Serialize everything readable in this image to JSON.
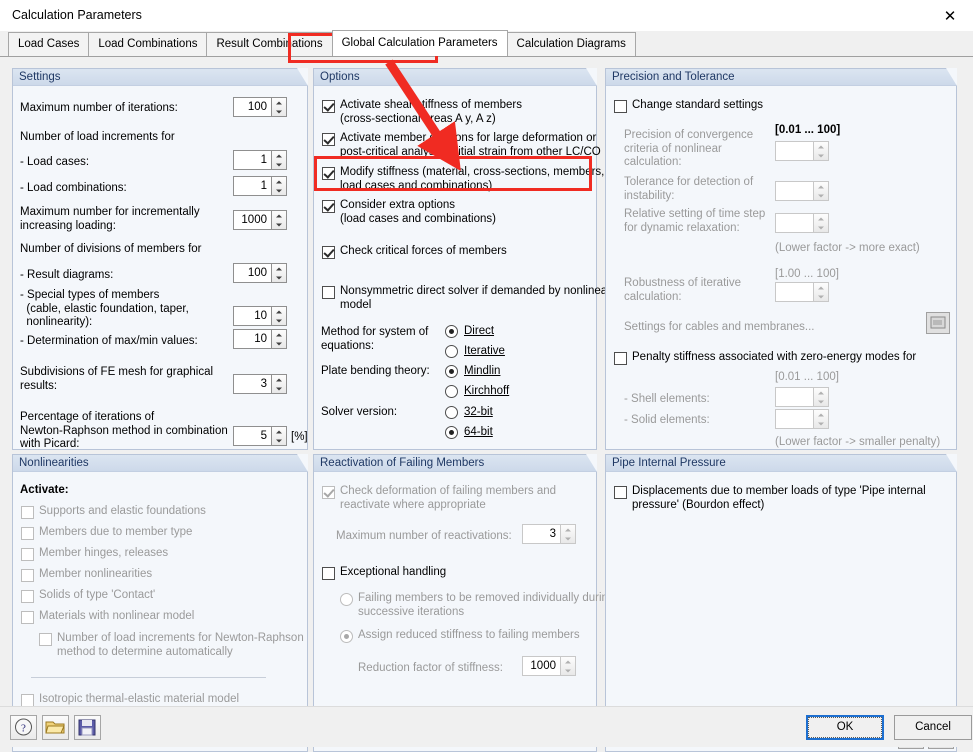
{
  "window": {
    "title": "Calculation Parameters",
    "close_icon": "close-icon"
  },
  "tabs": [
    {
      "label": "Load Cases",
      "active": false
    },
    {
      "label": "Load Combinations",
      "active": false
    },
    {
      "label": "Result Combinations",
      "active": false
    },
    {
      "label": "Global Calculation Parameters",
      "active": true
    },
    {
      "label": "Calculation Diagrams",
      "active": false
    }
  ],
  "settings": {
    "title": "Settings",
    "max_iterations_label": "Maximum number of iterations:",
    "max_iterations_value": "100",
    "load_increments_header": "Number of load increments for",
    "load_cases_label": "- Load cases:",
    "load_cases_value": "1",
    "load_combinations_label": "- Load combinations:",
    "load_combinations_value": "1",
    "incremental_label": "Maximum number for incrementally\nincreasing loading:",
    "incremental_value": "1000",
    "divisions_header": "Number of divisions of members for",
    "result_diagrams_label": "- Result diagrams:",
    "result_diagrams_value": "100",
    "special_members_label": "- Special types of members\n  (cable, elastic foundation, taper,\n  nonlinearity):",
    "special_members_value": "10",
    "maxmin_label": "- Determination of max/min values:",
    "maxmin_value": "10",
    "fe_mesh_label": "Subdivisions of FE mesh for graphical\nresults:",
    "fe_mesh_value": "3",
    "picard_label": "Percentage of iterations of\nNewton-Raphson method in combination\nwith Picard:",
    "picard_value": "5",
    "picard_unit": "[%]"
  },
  "options": {
    "title": "Options",
    "shear_stiffness": "Activate shear stiffness of members\n(cross-sectional areas A y, A z)",
    "shear_stiffness_checked": true,
    "member_divisions": "Activate member divisions for large deformation or\npost-critical analysis, initial strain from other LC/CO",
    "member_divisions_checked": true,
    "modify_stiffness": "Modify stiffness (material, cross-sections, members,\nload cases and combinations)",
    "modify_stiffness_checked": true,
    "extra_options": "Consider extra options\n(load cases and combinations)",
    "extra_options_checked": true,
    "critical_forces": "Check critical forces of members",
    "critical_forces_checked": true,
    "nonsymmetric_solver": "Nonsymmetric direct solver if demanded by nonlinear\nmodel",
    "nonsymmetric_solver_checked": false,
    "method_label": "Method for system of\nequations:",
    "method_direct": "Direct",
    "method_iterative": "Iterative",
    "method_selected": "Direct",
    "plate_label": "Plate bending theory:",
    "plate_mindlin": "Mindlin",
    "plate_kirchhoff": "Kirchhoff",
    "plate_selected": "Mindlin",
    "solver_label": "Solver version:",
    "solver_32": "32-bit",
    "solver_64": "64-bit",
    "solver_selected": "64-bit"
  },
  "precision": {
    "title": "Precision and Tolerance",
    "change_standard": "Change standard settings",
    "change_standard_checked": false,
    "range_001_100_a": "[0.01 ... 100]",
    "convergence_label": "Precision of convergence\ncriteria of nonlinear\ncalculation:",
    "convergence_value": "",
    "instability_label": "Tolerance for detection of\ninstability:",
    "instability_value": "",
    "timestep_label": "Relative setting of time step\nfor dynamic relaxation:",
    "timestep_value": "",
    "lower_more_exact": "(Lower factor -> more exact)",
    "range_100_100": "[1.00 ... 100]",
    "robustness_label": "Robustness of iterative\ncalculation:",
    "robustness_value": "",
    "cables_membranes": "Settings for cables and membranes...",
    "cables_membranes_icon": "settings-dialog-icon",
    "penalty_label": "Penalty stiffness associated with zero-energy modes for",
    "penalty_checked": false,
    "range_001_100_b": "[0.01 ... 100]",
    "shell_label": "- Shell elements:",
    "shell_value": "",
    "solid_label": "- Solid elements:",
    "solid_value": "",
    "lower_smaller_penalty": "(Lower factor -> smaller penalty)"
  },
  "nonlinearities": {
    "title": "Nonlinearities",
    "activate_label": "Activate:",
    "items": [
      {
        "label": "Supports and elastic foundations",
        "checked": false
      },
      {
        "label": "Members due to member type",
        "checked": false
      },
      {
        "label": "Member hinges, releases",
        "checked": false
      },
      {
        "label": "Member nonlinearities",
        "checked": false
      },
      {
        "label": "Solids of type 'Contact'",
        "checked": false
      },
      {
        "label": "Materials with nonlinear model",
        "checked": false
      }
    ],
    "newton_raphson": "Number of load increments for Newton-Raphson\nmethod to determine automatically",
    "newton_raphson_checked": false,
    "isotropic": "Isotropic thermal-elastic material model",
    "isotropic_checked": false
  },
  "reactivation": {
    "title": "Reactivation of Failing Members",
    "check_deformation": "Check deformation of failing members and\nreactivate where appropriate",
    "check_deformation_checked": true,
    "max_reactivations_label": "Maximum number of reactivations:",
    "max_reactivations_value": "3",
    "exceptional": "Exceptional handling",
    "exceptional_checked": false,
    "remove_individually": "Failing members to be removed individually during\nsuccessive iterations",
    "assign_reduced": "Assign reduced stiffness to failing members",
    "exceptional_selected": "Assign reduced stiffness to failing members",
    "reduction_label": "Reduction factor of stiffness:",
    "reduction_value": "1000"
  },
  "pipe": {
    "title": "Pipe Internal Pressure",
    "bourdon": "Displacements due to member loads of type 'Pipe internal\npressure' (Bourdon effect)",
    "bourdon_checked": false,
    "icon1": "copy-to-icon",
    "icon2": "copy-from-icon"
  },
  "footer": {
    "help_icon": "help-icon",
    "open_icon": "open-folder-icon",
    "save_icon": "save-disk-icon",
    "ok_label": "OK",
    "cancel_label": "Cancel"
  },
  "annotation": {
    "highlight_color": "#f02b22",
    "tab_box": "Global Calculation Parameters",
    "target_box": "Modify stiffness (material, cross-sections, members, load cases and combinations)"
  }
}
